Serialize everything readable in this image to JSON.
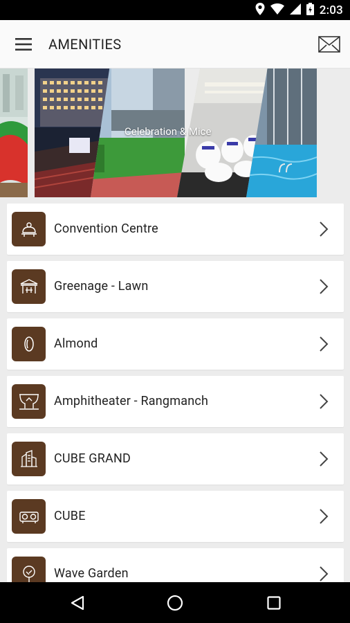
{
  "status_bar": {
    "time": "2:03"
  },
  "app_bar": {
    "title": "AMENITIES"
  },
  "banner": {
    "caption": "Celebration & Mice"
  },
  "amenities": [
    {
      "label": "Convention Centre",
      "icon": "reception-bell-icon"
    },
    {
      "label": "Greenage - Lawn",
      "icon": "pavilion-icon"
    },
    {
      "label": "Almond",
      "icon": "almond-icon"
    },
    {
      "label": "Amphitheater - Rangmanch",
      "icon": "stage-curtain-icon"
    },
    {
      "label": "CUBE GRAND",
      "icon": "building-icon"
    },
    {
      "label": "CUBE",
      "icon": "projector-icon"
    },
    {
      "label": "Wave Garden",
      "icon": "tree-icon"
    }
  ],
  "colors": {
    "icon_tile": "#5b3a22",
    "status_bar": "#000000",
    "app_bar": "#fafafa",
    "background": "#ececec"
  }
}
